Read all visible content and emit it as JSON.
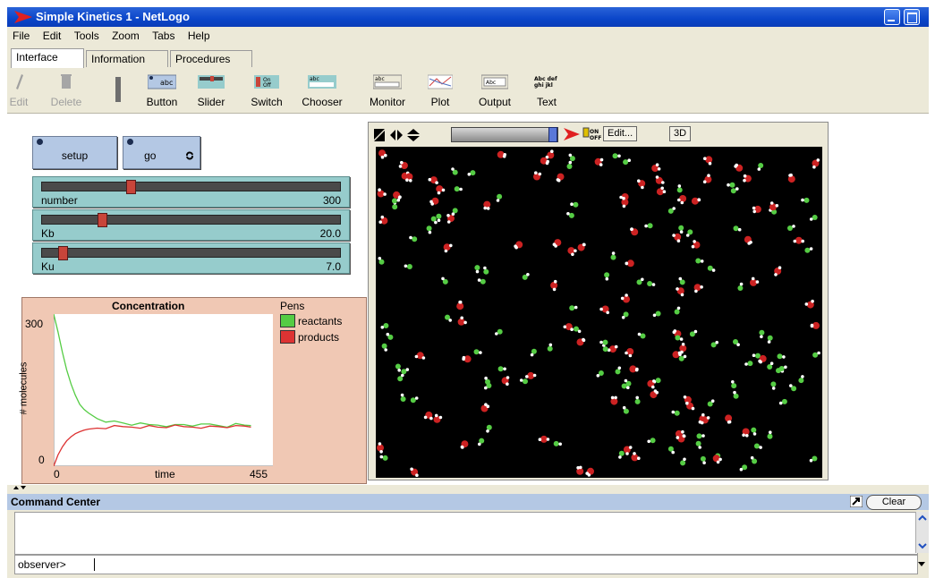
{
  "window": {
    "title": "Simple Kinetics 1 - NetLogo"
  },
  "menu": [
    "File",
    "Edit",
    "Tools",
    "Zoom",
    "Tabs",
    "Help"
  ],
  "tabs": [
    "Interface",
    "Information",
    "Procedures"
  ],
  "toolbar": {
    "edit": "Edit",
    "delete": "Delete",
    "button": "Button",
    "slider": "Slider",
    "switch": "Switch",
    "chooser": "Chooser",
    "monitor": "Monitor",
    "plot": "Plot",
    "output": "Output",
    "text": "Text"
  },
  "buttons": {
    "setup": "setup",
    "go": "go"
  },
  "sliders": [
    {
      "name": "number",
      "value": "300",
      "fraction": 0.3
    },
    {
      "name": "Kb",
      "value": "20.0",
      "fraction": 0.2
    },
    {
      "name": "Ku",
      "value": "7.0",
      "fraction": 0.07
    }
  ],
  "plot": {
    "title": "Concentration",
    "pens_label": "Pens",
    "xlabel": "time",
    "ylabel": "# molecules",
    "xmin": "0",
    "xmax": "455",
    "ymin": "0",
    "ymax": "300",
    "pens": [
      {
        "name": "reactants",
        "color": "#55cc44"
      },
      {
        "name": "products",
        "color": "#dd3333"
      }
    ]
  },
  "chart_data": {
    "type": "line",
    "title": "Concentration",
    "xlabel": "time",
    "ylabel": "# molecules",
    "xlim": [
      0,
      455
    ],
    "ylim": [
      0,
      300
    ],
    "legend": "right",
    "series": [
      {
        "name": "reactants",
        "color": "#55cc44",
        "x": [
          0,
          10,
          20,
          30,
          40,
          50,
          60,
          70,
          80,
          100,
          120,
          140,
          160,
          180,
          200,
          220,
          240,
          260,
          280,
          300,
          320,
          340,
          360,
          380,
          400,
          420,
          440,
          455
        ],
        "y": [
          300,
          265,
          225,
          190,
          162,
          140,
          122,
          112,
          105,
          95,
          90,
          87,
          85,
          83,
          82,
          81,
          82,
          81,
          80,
          82,
          81,
          80,
          82,
          81,
          80,
          82,
          81,
          82
        ]
      },
      {
        "name": "products",
        "color": "#dd3333",
        "x": [
          0,
          10,
          20,
          30,
          40,
          50,
          60,
          70,
          80,
          100,
          120,
          140,
          160,
          180,
          200,
          220,
          240,
          260,
          280,
          300,
          320,
          340,
          360,
          380,
          400,
          420,
          440,
          455
        ],
        "y": [
          0,
          22,
          38,
          50,
          58,
          64,
          68,
          71,
          73,
          75,
          76,
          77,
          77,
          78,
          78,
          78,
          77,
          78,
          78,
          77,
          78,
          78,
          77,
          78,
          78,
          77,
          78,
          78
        ]
      }
    ]
  },
  "view": {
    "edit_label": "Edit...",
    "threed_label": "3D"
  },
  "command_center": {
    "title": "Command Center",
    "clear": "Clear",
    "prompt": "observer>"
  },
  "colors": {
    "reactant": "#55cc44",
    "product": "#cc2222",
    "atom": "#ffffff",
    "title_bar": "#0a45c9"
  }
}
